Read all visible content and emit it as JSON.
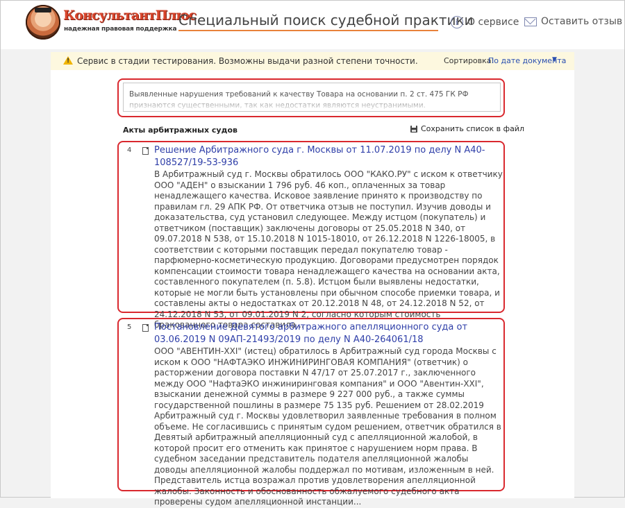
{
  "header": {
    "logo_title": "КонсультантПлюс",
    "logo_subtitle": "надежная правовая поддержка",
    "app_title": "Специальный поиск судебной практики",
    "about_label": "О сервисе",
    "feedback_label": "Оставить отзыв"
  },
  "notice": {
    "text": "Сервис в стадии тестирования. Возможны выдачи разной степени точности.",
    "sort_label": "Сортировка:",
    "sort_value": "По дате документа"
  },
  "query": {
    "text": "Выявленные нарушения требований к качеству Товара на основании п. 2 ст. 475 ГК РФ признаются существенными, так как недостатки являются неустранимыми."
  },
  "section": {
    "title": "Акты арбитражных судов",
    "save_label": "Сохранить список в файл"
  },
  "results": [
    {
      "number": "4",
      "title": "Решение Арбитражного суда г. Москвы от 11.07.2019 по делу N А40-108527/19-53-936",
      "snippet": "В Арбитражный суд г. Москвы обратилось ООО \"КАКО.РУ\" с иском к ответчику ООО \"АДЕН\" о взыскании 1 796 руб. 46 коп., оплаченных за товар ненадлежащего качества. Исковое заявление принято к производству по правилам гл. 29 АПК РФ. От ответчика отзыв не поступил. Изучив доводы и доказательства, суд установил следующее. Между истцом (покупатель) и ответчиком (поставщик) заключены договоры от 25.05.2018 N 340, от 09.07.2018 N 538, от 15.10.2018 N 1015-18010, от 26.12.2018 N 1226-18005, в соответствии с которыми поставщик передал покупателю товар - парфюмерно-косметическую продукцию. Договорами предусмотрен порядок компенсации стоимости товара ненадлежащего качества на основании акта, составленного покупателем (п. 5.8). Истцом были выявлены недостатки, которые не могли быть установлены при обычном способе приемки товара, и составлены акты о недостатках от 20.12.2018 N 48, от 24.12.2018 N 52, от 24.12.2018 N 53, от 09.01.2019 N 2, согласно которым стоимость бракованного товара составила..."
    },
    {
      "number": "5",
      "title": "Постановление Девятого арбитражного апелляционного суда от 03.06.2019 N 09АП-21493/2019 по делу N А40-264061/18",
      "snippet": "ООО \"АВЕНТИН-XXI\" (истец) обратилось в Арбитражный суд города Москвы с иском к ООО \"НАФТАЭКО ИНЖИНИРИНГОВАЯ КОМПАНИЯ\" (ответчик) о расторжении договора поставки N 47/17 от 25.07.2017 г., заключенного между ООО \"НафтаЭКО инжиниринговая компания\" и ООО \"Авентин-XXI\", взыскании денежной суммы в размере 9 227 000 руб., а также суммы государственной пошлины в размере 75 135 руб. Решением от 28.02.2019 Арбитражный суд г. Москвы удовлетворил заявленные требования в полном объеме. Не согласившись с принятым судом решением, ответчик обратился в Девятый арбитражный апелляционный суд с апелляционной жалобой, в которой просит его отменить как принятое с нарушением норм права. В судебном заседании представитель подателя апелляционной жалобы доводы апелляционной жалобы поддержал по мотивам, изложенным в ней. Представитель истца возражал против удовлетворения апелляционной жалобы. Законность и обоснованность обжалуемого судебного акта проверены судом апелляционной инстанции..."
    }
  ]
}
